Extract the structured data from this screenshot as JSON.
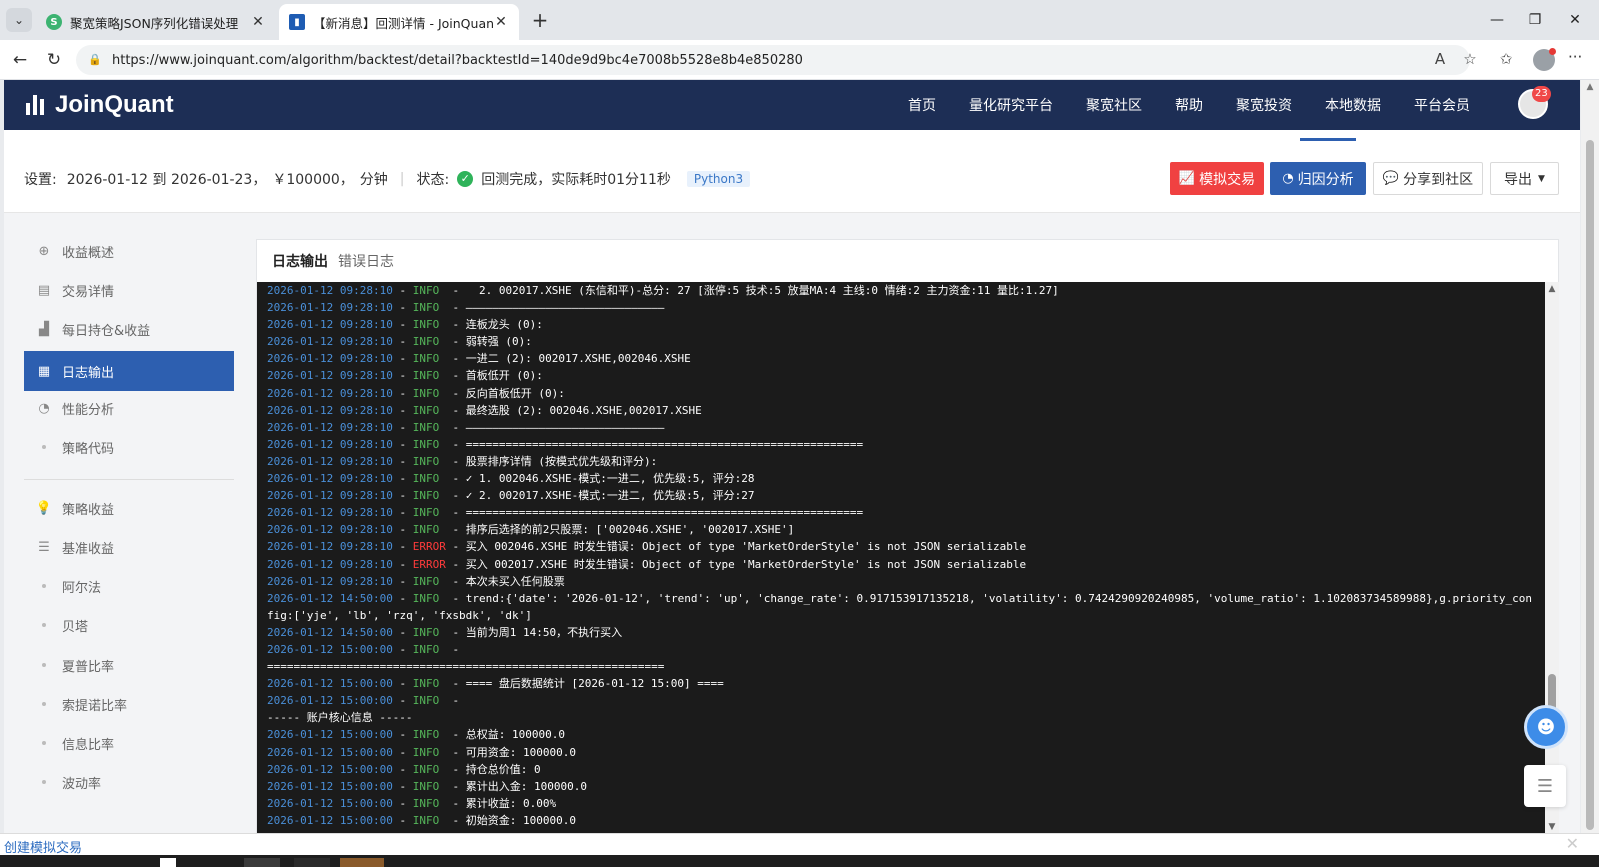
{
  "browser": {
    "tabs": [
      {
        "title": "聚宽策略JSON序列化错误处理",
        "favicon": "green",
        "active": false
      },
      {
        "title": "【新消息】回测详情 - JoinQuant",
        "favicon": "blue",
        "active": true
      }
    ],
    "url": "https://www.joinquant.com/algorithm/backtest/detail?backtestId=140de9d9bc4e7008b5528e8b4e850280",
    "window_controls": [
      "minimize-icon",
      "restore-icon",
      "close-icon"
    ]
  },
  "site": {
    "logo": "JoinQuant",
    "nav": [
      "首页",
      "量化研究平台",
      "聚宽社区",
      "帮助",
      "聚宽投资",
      "本地数据",
      "平台会员"
    ],
    "notification_count": "23"
  },
  "settings": {
    "label": "设置:",
    "range": "2026-01-12 到 2026-01-23，",
    "capital": "￥100000，",
    "frequency": "分钟",
    "status_label": "状态:",
    "status_text": "回测完成，实际耗时01分11秒",
    "language": "Python3"
  },
  "actions": {
    "simulate": "模拟交易",
    "attribution": "归因分析",
    "share": "分享到社区",
    "export": "导出"
  },
  "sidebar": {
    "items": [
      {
        "label": "收益概述",
        "icon": "dashboard-icon",
        "active": false
      },
      {
        "label": "交易详情",
        "icon": "document-icon",
        "active": false
      },
      {
        "label": "每日持仓&收益",
        "icon": "chart-icon",
        "active": false
      },
      {
        "label": "日志输出",
        "icon": "log-icon",
        "active": true
      },
      {
        "label": "性能分析",
        "icon": "pie-icon",
        "active": false
      },
      {
        "label": "策略代码",
        "icon": "dot",
        "active": false
      }
    ],
    "items2": [
      {
        "label": "策略收益",
        "icon": "bulb-icon"
      },
      {
        "label": "基准收益",
        "icon": "database-icon"
      },
      {
        "label": "阿尔法",
        "icon": "dot"
      },
      {
        "label": "贝塔",
        "icon": "dot"
      },
      {
        "label": "夏普比率",
        "icon": "dot"
      },
      {
        "label": "索提诺比率",
        "icon": "dot"
      },
      {
        "label": "信息比率",
        "icon": "dot"
      },
      {
        "label": "波动率",
        "icon": "dot"
      }
    ]
  },
  "log_panel": {
    "tab_log": "日志输出",
    "tab_error": "错误日志",
    "lines": [
      {
        "ts": "2026-01-12 09:28:10",
        "level": "INFO",
        "msg": "  2. 002017.XSHE (东信和平)-总分: 27 [涨停:5 技术:5 放量MA:4 主线:0 情绪:2 主力资金:11 量比:1.27]"
      },
      {
        "ts": "2026-01-12 09:28:10",
        "level": "INFO",
        "msg": "——————————————————————————————"
      },
      {
        "ts": "2026-01-12 09:28:10",
        "level": "INFO",
        "msg": "连板龙头 (0):"
      },
      {
        "ts": "2026-01-12 09:28:10",
        "level": "INFO",
        "msg": "弱转强 (0):"
      },
      {
        "ts": "2026-01-12 09:28:10",
        "level": "INFO",
        "msg": "一进二 (2): 002017.XSHE,002046.XSHE"
      },
      {
        "ts": "2026-01-12 09:28:10",
        "level": "INFO",
        "msg": "首板低开 (0):"
      },
      {
        "ts": "2026-01-12 09:28:10",
        "level": "INFO",
        "msg": "反向首板低开 (0):"
      },
      {
        "ts": "2026-01-12 09:28:10",
        "level": "INFO",
        "msg": "最终选股 (2): 002046.XSHE,002017.XSHE"
      },
      {
        "ts": "2026-01-12 09:28:10",
        "level": "INFO",
        "msg": "——————————————————————————————"
      },
      {
        "ts": "2026-01-12 09:28:10",
        "level": "INFO",
        "msg": "============================================================"
      },
      {
        "ts": "2026-01-12 09:28:10",
        "level": "INFO",
        "msg": "股票排序详情 (按模式优先级和评分):"
      },
      {
        "ts": "2026-01-12 09:28:10",
        "level": "INFO",
        "msg": "✓ 1. 002046.XSHE-模式:一进二, 优先级:5, 评分:28"
      },
      {
        "ts": "2026-01-12 09:28:10",
        "level": "INFO",
        "msg": "✓ 2. 002017.XSHE-模式:一进二, 优先级:5, 评分:27"
      },
      {
        "ts": "2026-01-12 09:28:10",
        "level": "INFO",
        "msg": "============================================================"
      },
      {
        "ts": "2026-01-12 09:28:10",
        "level": "INFO",
        "msg": "排序后选择的前2只股票: ['002046.XSHE', '002017.XSHE']"
      },
      {
        "ts": "2026-01-12 09:28:10",
        "level": "ERROR",
        "msg": "买入 002046.XSHE 时发生错误: Object of type 'MarketOrderStyle' is not JSON serializable"
      },
      {
        "ts": "2026-01-12 09:28:10",
        "level": "ERROR",
        "msg": "买入 002017.XSHE 时发生错误: Object of type 'MarketOrderStyle' is not JSON serializable"
      },
      {
        "ts": "2026-01-12 09:28:10",
        "level": "INFO",
        "msg": "本次未买入任何股票"
      },
      {
        "ts": "2026-01-12 14:50:00",
        "level": "INFO",
        "msg": "trend:{'date': '2026-01-12', 'trend': 'up', 'change_rate': 0.917153917135218, 'volatility': 0.7424290920240985, 'volume_ratio': 1.102083734589988},g.priority_config:['yje', 'lb', 'rzq', 'fxsbdk', 'dk']",
        "wrap": true
      },
      {
        "ts": "2026-01-12 14:50:00",
        "level": "INFO",
        "msg": "当前为周1 14:50，不执行买入"
      },
      {
        "ts": "2026-01-12 15:00:00",
        "level": "INFO",
        "msg": ""
      },
      {
        "raw": "============================================================"
      },
      {
        "ts": "2026-01-12 15:00:00",
        "level": "INFO",
        "msg": "==== 盘后数据统计 [2026-01-12 15:00] ===="
      },
      {
        "ts": "2026-01-12 15:00:00",
        "level": "INFO",
        "msg": ""
      },
      {
        "raw": "----- 账户核心信息 -----"
      },
      {
        "ts": "2026-01-12 15:00:00",
        "level": "INFO",
        "msg": "总权益: 100000.0"
      },
      {
        "ts": "2026-01-12 15:00:00",
        "level": "INFO",
        "msg": "可用资金: 100000.0"
      },
      {
        "ts": "2026-01-12 15:00:00",
        "level": "INFO",
        "msg": "持仓总价值: 0"
      },
      {
        "ts": "2026-01-12 15:00:00",
        "level": "INFO",
        "msg": "累计出入金: 100000.0"
      },
      {
        "ts": "2026-01-12 15:00:00",
        "level": "INFO",
        "msg": "累计收益: 0.00%"
      },
      {
        "ts": "2026-01-12 15:00:00",
        "level": "INFO",
        "msg": "初始资金: 100000.0"
      }
    ]
  },
  "status_bar": {
    "link": "创建模拟交易"
  },
  "colors": {
    "header_bg": "#1d2e55",
    "primary": "#2d5fb0",
    "danger": "#f04141",
    "console_bg": "#1b1b1b",
    "ts": "#4a8fd8",
    "info": "#55b65a",
    "error": "#ff3b3b"
  }
}
